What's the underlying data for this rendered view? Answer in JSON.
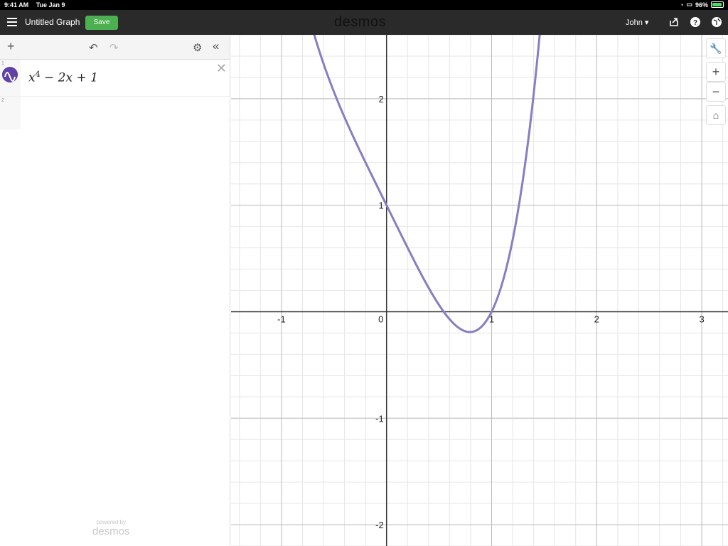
{
  "status": {
    "time": "9:41 AM",
    "date": "Tue Jan 9",
    "battery": "96%"
  },
  "header": {
    "title": "Untitled Graph",
    "save_label": "Save",
    "logo": "desmos",
    "user": "John"
  },
  "expressions": [
    {
      "index": "1",
      "latex_base": "x",
      "latex_exp": "4",
      "latex_rest": " − 2x + 1",
      "color": "#6042a6"
    },
    {
      "index": "2"
    }
  ],
  "footer": {
    "powered_by": "powered by",
    "brand": "desmos"
  },
  "graph": {
    "x_ticks": [
      "-1",
      "0",
      "1",
      "2",
      "3"
    ],
    "y_ticks": [
      "2",
      "1",
      "-1",
      "-2"
    ],
    "curve_color": "#8a7cc0"
  },
  "chart_data": {
    "type": "line",
    "function": "x^4 - 2x + 1",
    "xlim": [
      -1.48,
      3.25
    ],
    "ylim": [
      -2.2,
      2.6
    ],
    "grid": true
  }
}
